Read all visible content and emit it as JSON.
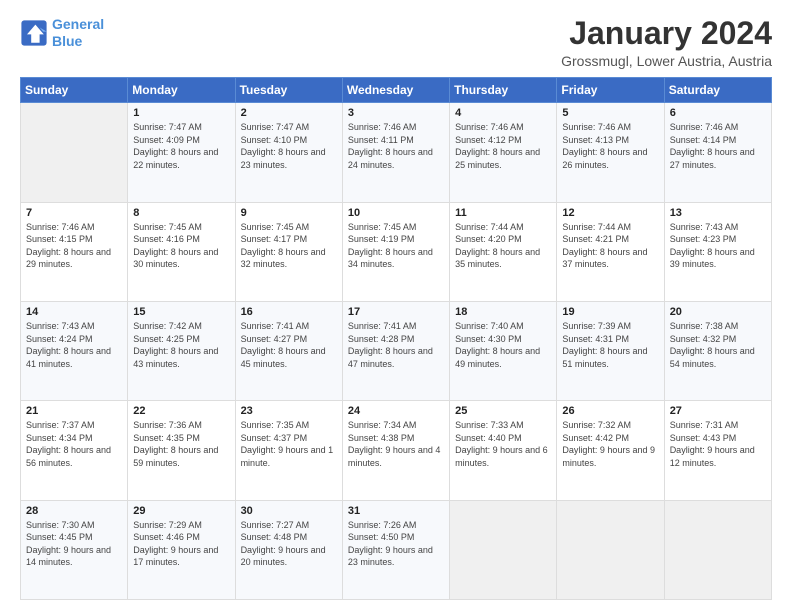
{
  "logo": {
    "line1": "General",
    "line2": "Blue"
  },
  "title": "January 2024",
  "subtitle": "Grossmugl, Lower Austria, Austria",
  "days_of_week": [
    "Sunday",
    "Monday",
    "Tuesday",
    "Wednesday",
    "Thursday",
    "Friday",
    "Saturday"
  ],
  "weeks": [
    [
      {
        "num": "",
        "sunrise": "",
        "sunset": "",
        "daylight": "",
        "empty": true
      },
      {
        "num": "1",
        "sunrise": "Sunrise: 7:47 AM",
        "sunset": "Sunset: 4:09 PM",
        "daylight": "Daylight: 8 hours and 22 minutes."
      },
      {
        "num": "2",
        "sunrise": "Sunrise: 7:47 AM",
        "sunset": "Sunset: 4:10 PM",
        "daylight": "Daylight: 8 hours and 23 minutes."
      },
      {
        "num": "3",
        "sunrise": "Sunrise: 7:46 AM",
        "sunset": "Sunset: 4:11 PM",
        "daylight": "Daylight: 8 hours and 24 minutes."
      },
      {
        "num": "4",
        "sunrise": "Sunrise: 7:46 AM",
        "sunset": "Sunset: 4:12 PM",
        "daylight": "Daylight: 8 hours and 25 minutes."
      },
      {
        "num": "5",
        "sunrise": "Sunrise: 7:46 AM",
        "sunset": "Sunset: 4:13 PM",
        "daylight": "Daylight: 8 hours and 26 minutes."
      },
      {
        "num": "6",
        "sunrise": "Sunrise: 7:46 AM",
        "sunset": "Sunset: 4:14 PM",
        "daylight": "Daylight: 8 hours and 27 minutes."
      }
    ],
    [
      {
        "num": "7",
        "sunrise": "Sunrise: 7:46 AM",
        "sunset": "Sunset: 4:15 PM",
        "daylight": "Daylight: 8 hours and 29 minutes."
      },
      {
        "num": "8",
        "sunrise": "Sunrise: 7:45 AM",
        "sunset": "Sunset: 4:16 PM",
        "daylight": "Daylight: 8 hours and 30 minutes."
      },
      {
        "num": "9",
        "sunrise": "Sunrise: 7:45 AM",
        "sunset": "Sunset: 4:17 PM",
        "daylight": "Daylight: 8 hours and 32 minutes."
      },
      {
        "num": "10",
        "sunrise": "Sunrise: 7:45 AM",
        "sunset": "Sunset: 4:19 PM",
        "daylight": "Daylight: 8 hours and 34 minutes."
      },
      {
        "num": "11",
        "sunrise": "Sunrise: 7:44 AM",
        "sunset": "Sunset: 4:20 PM",
        "daylight": "Daylight: 8 hours and 35 minutes."
      },
      {
        "num": "12",
        "sunrise": "Sunrise: 7:44 AM",
        "sunset": "Sunset: 4:21 PM",
        "daylight": "Daylight: 8 hours and 37 minutes."
      },
      {
        "num": "13",
        "sunrise": "Sunrise: 7:43 AM",
        "sunset": "Sunset: 4:23 PM",
        "daylight": "Daylight: 8 hours and 39 minutes."
      }
    ],
    [
      {
        "num": "14",
        "sunrise": "Sunrise: 7:43 AM",
        "sunset": "Sunset: 4:24 PM",
        "daylight": "Daylight: 8 hours and 41 minutes."
      },
      {
        "num": "15",
        "sunrise": "Sunrise: 7:42 AM",
        "sunset": "Sunset: 4:25 PM",
        "daylight": "Daylight: 8 hours and 43 minutes."
      },
      {
        "num": "16",
        "sunrise": "Sunrise: 7:41 AM",
        "sunset": "Sunset: 4:27 PM",
        "daylight": "Daylight: 8 hours and 45 minutes."
      },
      {
        "num": "17",
        "sunrise": "Sunrise: 7:41 AM",
        "sunset": "Sunset: 4:28 PM",
        "daylight": "Daylight: 8 hours and 47 minutes."
      },
      {
        "num": "18",
        "sunrise": "Sunrise: 7:40 AM",
        "sunset": "Sunset: 4:30 PM",
        "daylight": "Daylight: 8 hours and 49 minutes."
      },
      {
        "num": "19",
        "sunrise": "Sunrise: 7:39 AM",
        "sunset": "Sunset: 4:31 PM",
        "daylight": "Daylight: 8 hours and 51 minutes."
      },
      {
        "num": "20",
        "sunrise": "Sunrise: 7:38 AM",
        "sunset": "Sunset: 4:32 PM",
        "daylight": "Daylight: 8 hours and 54 minutes."
      }
    ],
    [
      {
        "num": "21",
        "sunrise": "Sunrise: 7:37 AM",
        "sunset": "Sunset: 4:34 PM",
        "daylight": "Daylight: 8 hours and 56 minutes."
      },
      {
        "num": "22",
        "sunrise": "Sunrise: 7:36 AM",
        "sunset": "Sunset: 4:35 PM",
        "daylight": "Daylight: 8 hours and 59 minutes."
      },
      {
        "num": "23",
        "sunrise": "Sunrise: 7:35 AM",
        "sunset": "Sunset: 4:37 PM",
        "daylight": "Daylight: 9 hours and 1 minute."
      },
      {
        "num": "24",
        "sunrise": "Sunrise: 7:34 AM",
        "sunset": "Sunset: 4:38 PM",
        "daylight": "Daylight: 9 hours and 4 minutes."
      },
      {
        "num": "25",
        "sunrise": "Sunrise: 7:33 AM",
        "sunset": "Sunset: 4:40 PM",
        "daylight": "Daylight: 9 hours and 6 minutes."
      },
      {
        "num": "26",
        "sunrise": "Sunrise: 7:32 AM",
        "sunset": "Sunset: 4:42 PM",
        "daylight": "Daylight: 9 hours and 9 minutes."
      },
      {
        "num": "27",
        "sunrise": "Sunrise: 7:31 AM",
        "sunset": "Sunset: 4:43 PM",
        "daylight": "Daylight: 9 hours and 12 minutes."
      }
    ],
    [
      {
        "num": "28",
        "sunrise": "Sunrise: 7:30 AM",
        "sunset": "Sunset: 4:45 PM",
        "daylight": "Daylight: 9 hours and 14 minutes."
      },
      {
        "num": "29",
        "sunrise": "Sunrise: 7:29 AM",
        "sunset": "Sunset: 4:46 PM",
        "daylight": "Daylight: 9 hours and 17 minutes."
      },
      {
        "num": "30",
        "sunrise": "Sunrise: 7:27 AM",
        "sunset": "Sunset: 4:48 PM",
        "daylight": "Daylight: 9 hours and 20 minutes."
      },
      {
        "num": "31",
        "sunrise": "Sunrise: 7:26 AM",
        "sunset": "Sunset: 4:50 PM",
        "daylight": "Daylight: 9 hours and 23 minutes."
      },
      {
        "num": "",
        "sunrise": "",
        "sunset": "",
        "daylight": "",
        "empty": true
      },
      {
        "num": "",
        "sunrise": "",
        "sunset": "",
        "daylight": "",
        "empty": true
      },
      {
        "num": "",
        "sunrise": "",
        "sunset": "",
        "daylight": "",
        "empty": true
      }
    ]
  ]
}
